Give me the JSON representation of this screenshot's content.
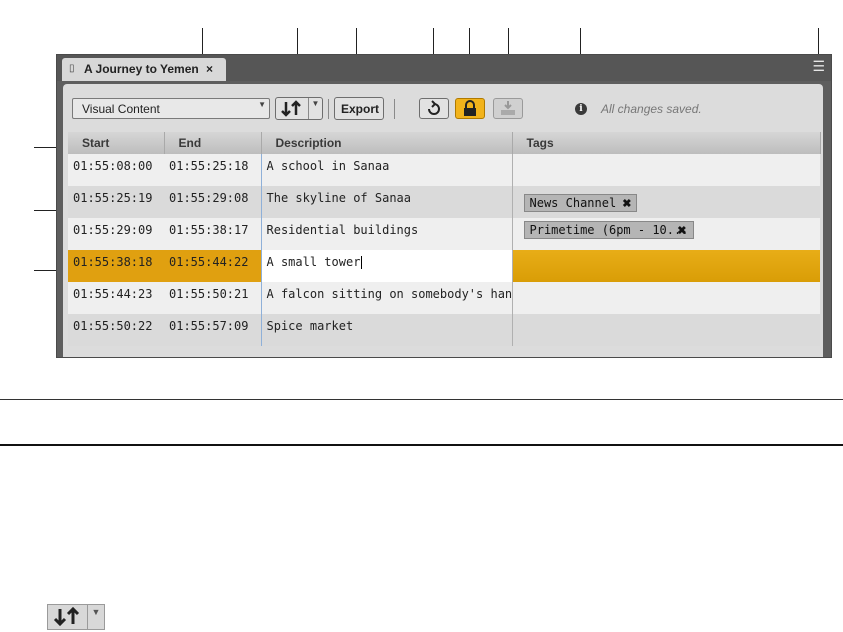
{
  "window": {
    "tab_title": "A Journey to Yemen",
    "tab_close": "×",
    "panel_menu_icon": "hamburger-menu-icon"
  },
  "toolbar": {
    "content_dropdown": "Visual Content",
    "sort_icon": "sort-up-down-arrows-icon",
    "export_label": "Export",
    "refresh_icon": "refresh-icon",
    "lock_icon": "lock-icon",
    "import_icon": "import-tray-icon",
    "status_icon": "info-icon",
    "status_text": "All changes saved."
  },
  "table": {
    "columns": [
      "Start",
      "End",
      "Description",
      "Tags"
    ],
    "rows": [
      {
        "start": "01:55:08:00",
        "end": "01:55:25:18",
        "description": "A school in Sanaa",
        "tags": []
      },
      {
        "start": "01:55:25:19",
        "end": "01:55:29:08",
        "description": "The skyline of Sanaa",
        "tags": [
          "News Channel"
        ]
      },
      {
        "start": "01:55:29:09",
        "end": "01:55:38:17",
        "description": "Residential buildings",
        "tags": [
          "Primetime (6pm - 10..."
        ]
      },
      {
        "start": "01:55:38:18",
        "end": "01:55:44:22",
        "description": "A small tower",
        "tags": [],
        "selected": true
      },
      {
        "start": "01:55:44:23",
        "end": "01:55:50:21",
        "description": "A falcon sitting on somebody's hand",
        "tags": []
      },
      {
        "start": "01:55:50:22",
        "end": "01:55:57:09",
        "description": "Spice market",
        "tags": []
      }
    ]
  },
  "colors": {
    "accent": "#e0a010",
    "panel_bg": "#5e5e5e"
  }
}
